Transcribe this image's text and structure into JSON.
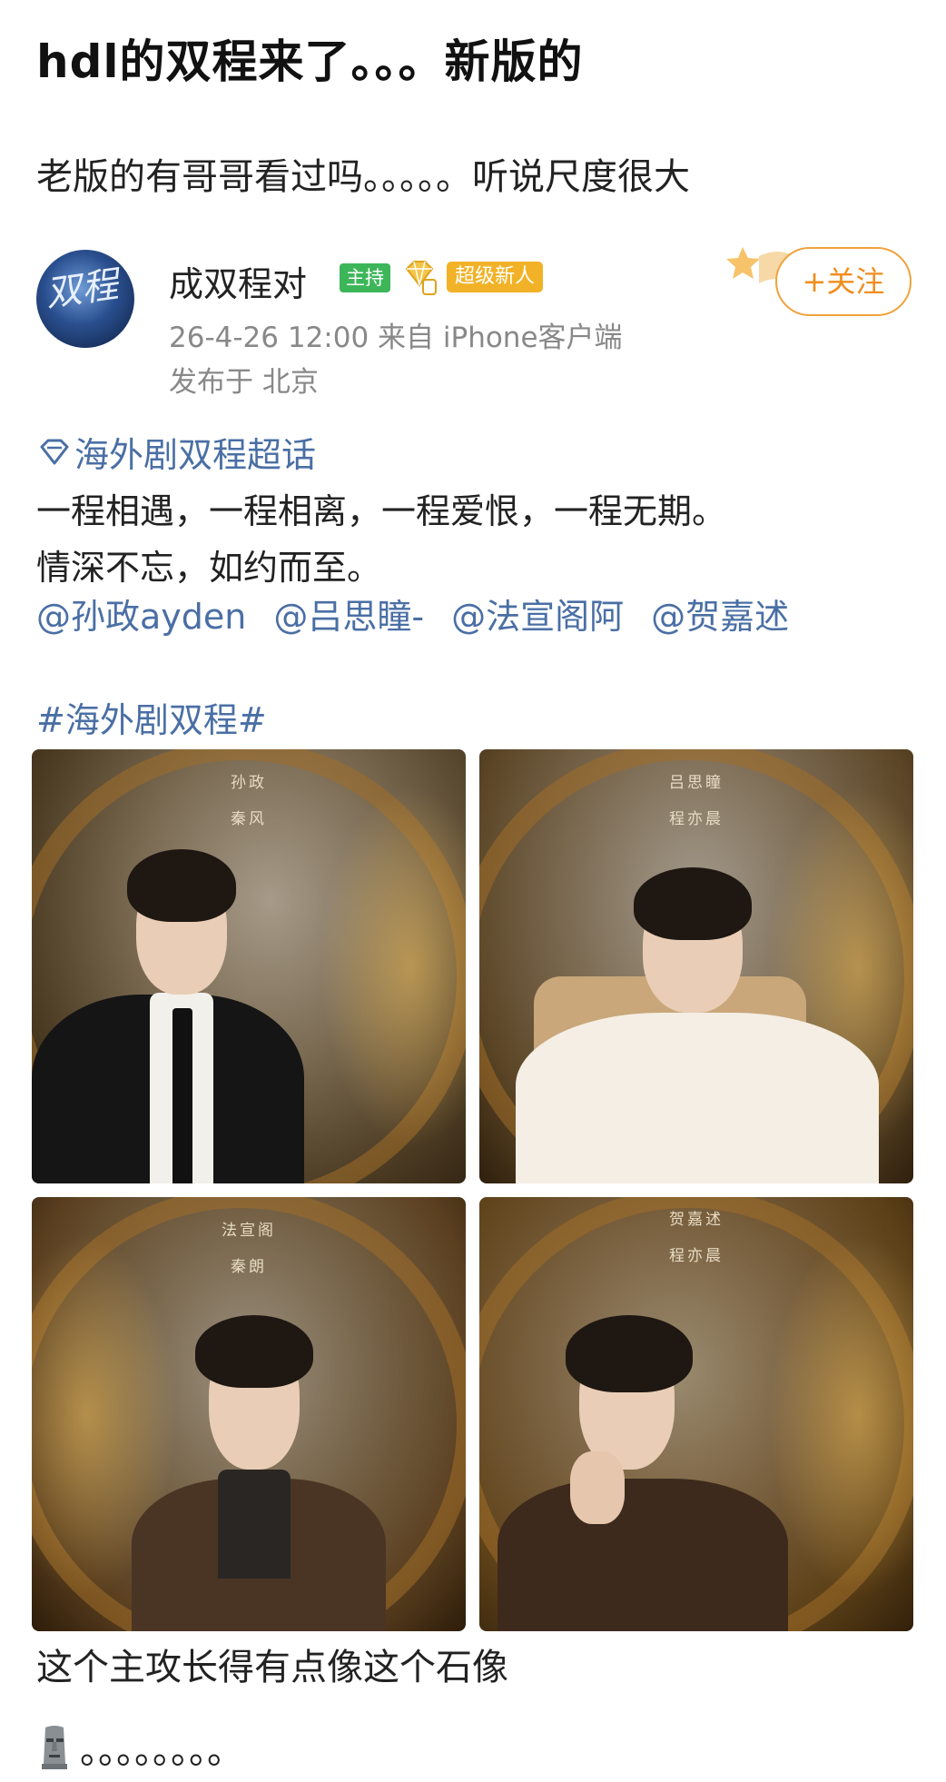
{
  "post": {
    "title": "hdl的双程来了。。。新版的",
    "subtitle": "老版的有哥哥看过吗。。。。。听说尺度很大"
  },
  "author": {
    "avatar_text": "双程",
    "name": "成双程对",
    "badge_host": "主持",
    "badge_newbie": "超级新人",
    "follow_label": "+关注",
    "meta": "26-4-26 12:00  来自 iPhone客户端",
    "location": "发布于 北京"
  },
  "content": {
    "topic_icon": "diamond-icon",
    "topic": "海外剧双程超话",
    "line1": "一程相遇，一程相离，一程爱恨，一程无期。",
    "line2": "情深不忘，如约而至。",
    "mentions": [
      "@孙政ayden",
      "@吕思瞳-",
      "@法宣阁阿",
      "@贺嘉述"
    ],
    "hashtag": "#海外剧双程#"
  },
  "photos": [
    {
      "name": "孙政",
      "role": "秦风"
    },
    {
      "name": "吕思瞳",
      "role": "程亦晨"
    },
    {
      "name": "法宣阁",
      "role": "秦朗"
    },
    {
      "name": "贺嘉述",
      "role": "程亦晨"
    }
  ],
  "comment": {
    "text": "这个主攻长得有点像这个石像",
    "emoji_icon": "moai-icon",
    "dots": "。。。。。。。。"
  },
  "colors": {
    "link": "#4a6fa5",
    "follow": "#f08d1e",
    "badge_host": "#3db65a",
    "badge_newbie": "#f2b227"
  }
}
